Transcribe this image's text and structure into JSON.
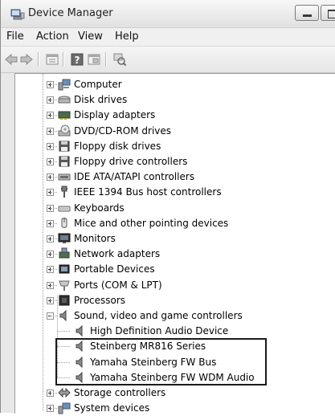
{
  "window": {
    "title": "Device Manager"
  },
  "menu": {
    "items": [
      "File",
      "Action",
      "View",
      "Help"
    ]
  },
  "toolbar": {
    "buttons": [
      "back-icon",
      "forward-icon",
      "properties-icon",
      "help-icon",
      "show-hide-console-tree-icon",
      "scan-hardware-icon"
    ]
  },
  "tree": {
    "categories": [
      "Computer",
      "Disk drives",
      "Display adapters",
      "DVD/CD-ROM drives",
      "Floppy disk drives",
      "Floppy drive controllers",
      "IDE ATA/ATAPI controllers",
      "IEEE 1394 Bus host controllers",
      "Keyboards",
      "Mice and other pointing devices",
      "Monitors",
      "Network adapters",
      "Portable Devices",
      "Ports (COM & LPT)",
      "Processors",
      "Sound, video and game controllers"
    ],
    "sound_children": [
      "High Definition Audio Device",
      "Steinberg MR816 Series",
      "Yamaha Steinberg FW Bus",
      "Yamaha Steinberg FW WDM Audio"
    ],
    "after": [
      "Storage controllers",
      "System devices"
    ]
  }
}
